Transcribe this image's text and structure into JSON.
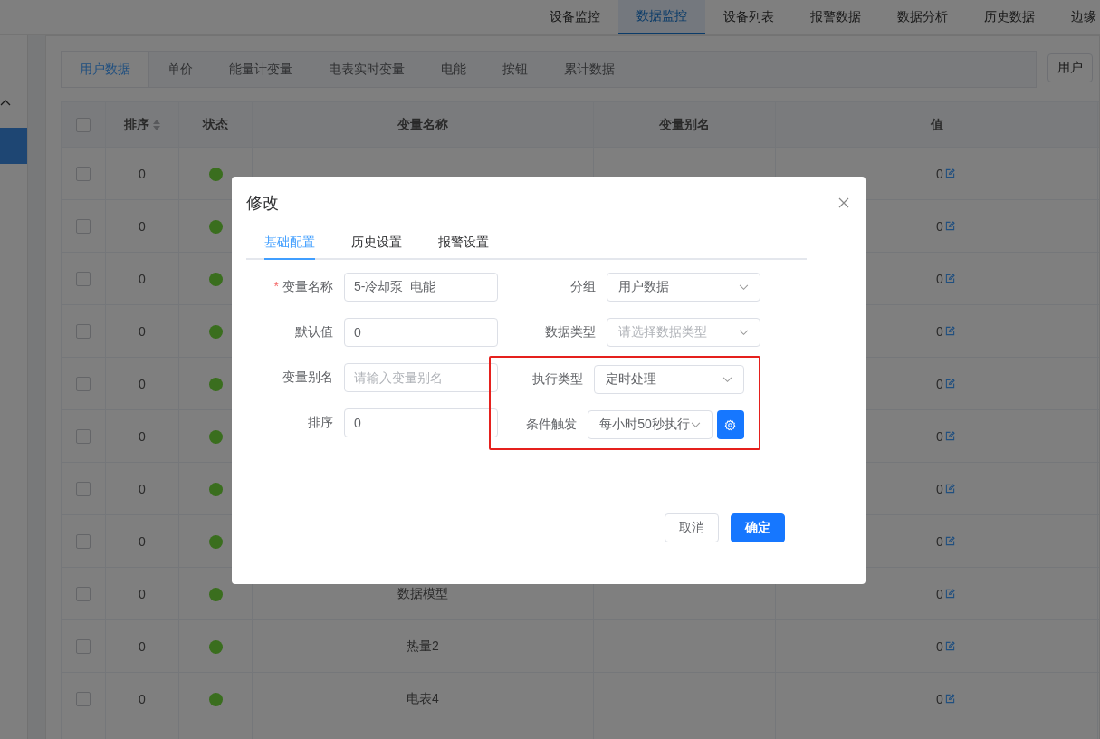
{
  "top_nav": {
    "items": [
      {
        "label": "设备监控",
        "selected": false
      },
      {
        "label": "数据监控",
        "selected": true
      },
      {
        "label": "设备列表",
        "selected": false
      },
      {
        "label": "报警数据",
        "selected": false
      },
      {
        "label": "数据分析",
        "selected": false
      },
      {
        "label": "历史数据",
        "selected": false
      },
      {
        "label": "边缘",
        "selected": false
      }
    ]
  },
  "sidebar": {
    "items": [
      {
        "selected": true
      }
    ]
  },
  "group_tabs": {
    "items": [
      {
        "label": "用户数据",
        "selected": true
      },
      {
        "label": "单价",
        "selected": false
      },
      {
        "label": "能量计变量",
        "selected": false
      },
      {
        "label": "电表实时变量",
        "selected": false
      },
      {
        "label": "电能",
        "selected": false
      },
      {
        "label": "按钮",
        "selected": false
      },
      {
        "label": "累计数据",
        "selected": false
      }
    ],
    "group_select": {
      "value": "用户"
    }
  },
  "table": {
    "header_checked": false,
    "columns": [
      "排序",
      "状态",
      "变量名称",
      "变量别名",
      "值"
    ],
    "rows": [
      {
        "checked": false,
        "order": "0",
        "color": "#3a6e1e",
        "value": "0"
      },
      {
        "checked": false,
        "order": "0",
        "color": "#3a6e1e",
        "value": "0"
      },
      {
        "checked": false,
        "order": "0",
        "color": "#3a6e1e",
        "value": "0"
      },
      {
        "checked": false,
        "order": "0",
        "color": "#3a6e1e",
        "value": "0"
      },
      {
        "checked": false,
        "order": "0",
        "color": "#3a6e1e",
        "value": "0"
      },
      {
        "checked": false,
        "order": "0",
        "color": "#3a6e1e",
        "value": "0"
      },
      {
        "checked": false,
        "order": "0",
        "color": "#3a6e1e",
        "value": "0"
      },
      {
        "checked": false,
        "order": "0",
        "color": "#3a6e1e",
        "value": "0"
      },
      {
        "checked": false,
        "order": "0",
        "color": "#3a6e1e",
        "name": "数据模型",
        "value": "0"
      },
      {
        "checked": false,
        "order": "0",
        "color": "#3a6e1e",
        "name": "热量2",
        "value": "0"
      },
      {
        "checked": false,
        "order": "0",
        "color": "#3a6e1e",
        "name": "电表4",
        "value": "0"
      }
    ]
  },
  "dialog": {
    "title": "修改",
    "tabs": [
      {
        "label": "基础配置",
        "selected": true
      },
      {
        "label": "历史设置",
        "selected": false
      },
      {
        "label": "报警设置",
        "selected": false
      }
    ],
    "left_fields": [
      {
        "label": "变量名称",
        "required_mark": "*",
        "value": "5-冷却泵_电能"
      },
      {
        "label": "默认值",
        "value": "0"
      },
      {
        "label": "变量别名",
        "placeholder": "请输入变量别名"
      },
      {
        "label": "排序",
        "value": "0"
      }
    ],
    "right_fields": [
      {
        "label": "分组",
        "kind": "select",
        "value": "用户数据"
      },
      {
        "label": "数据类型",
        "kind": "select",
        "placeholder": "请选择数据类型"
      }
    ],
    "highlighted_fields": [
      {
        "label": "执行类型",
        "kind": "select",
        "value": "定时处理"
      },
      {
        "label": "条件触发",
        "kind": "select_with_button",
        "value": "每小时50秒执行"
      }
    ],
    "buttons": [
      {
        "label": "取消",
        "kind": "default"
      },
      {
        "label": "确定",
        "kind": "primary"
      }
    ]
  }
}
